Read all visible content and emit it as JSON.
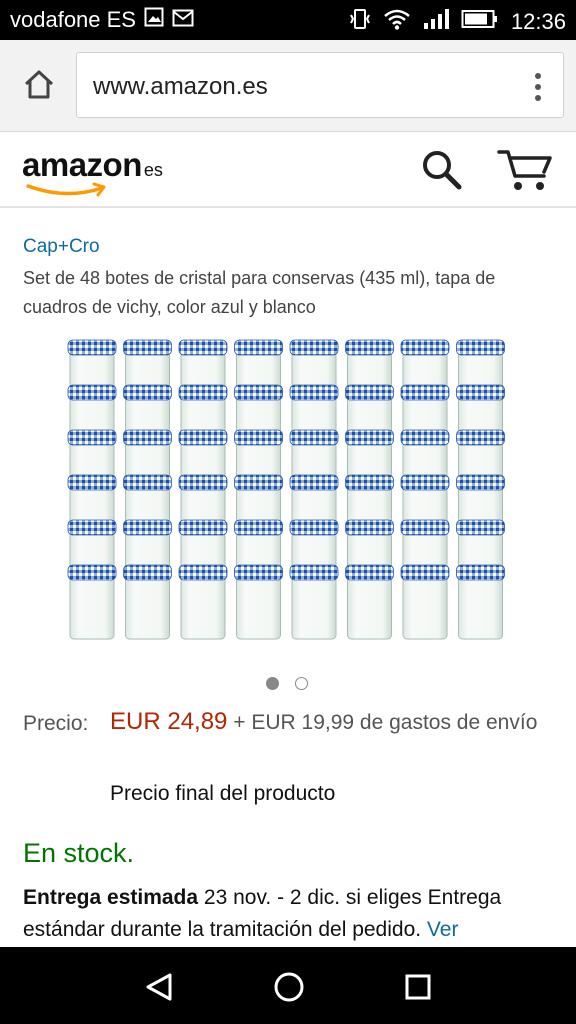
{
  "status_bar": {
    "carrier": "vodafone ES",
    "time": "12:36",
    "icons": [
      "image-icon",
      "mail-icon",
      "vibrate-icon",
      "wifi-icon",
      "signal-icon",
      "battery-icon"
    ]
  },
  "browser": {
    "url": "www.amazon.es",
    "home_icon": "home-icon",
    "menu_icon": "more-vert-icon"
  },
  "header": {
    "logo_main": "amazon",
    "logo_tld": "es",
    "search_icon": "search-icon",
    "cart_icon": "cart-icon",
    "brand_color": "#ff9900"
  },
  "product": {
    "brand": "Cap+Cro",
    "title": "Set de 48 botes de cristal para conservas (435 ml), tapa de cuadros de vichy, color azul y blanco",
    "image_carousel": {
      "count": 2,
      "active_index": 0
    },
    "price_label": "Precio:",
    "price": "EUR 24,89",
    "shipping": "+ EUR 19,99 de gastos de envío",
    "price_note": "Precio final del producto",
    "stock": "En stock.",
    "delivery_bold": "Entrega estimada",
    "delivery_text": " 23 nov. - 2 dic. si eliges Entrega estándar durante la tramitación del pedido. ",
    "delivery_link": "Ver"
  },
  "colors": {
    "price": "#b12704",
    "stock": "#007600",
    "link": "#0f6c9e"
  },
  "nav_bar": {
    "back_icon": "back-triangle-icon",
    "home_icon": "home-circle-icon",
    "recent_icon": "recent-apps-icon"
  }
}
